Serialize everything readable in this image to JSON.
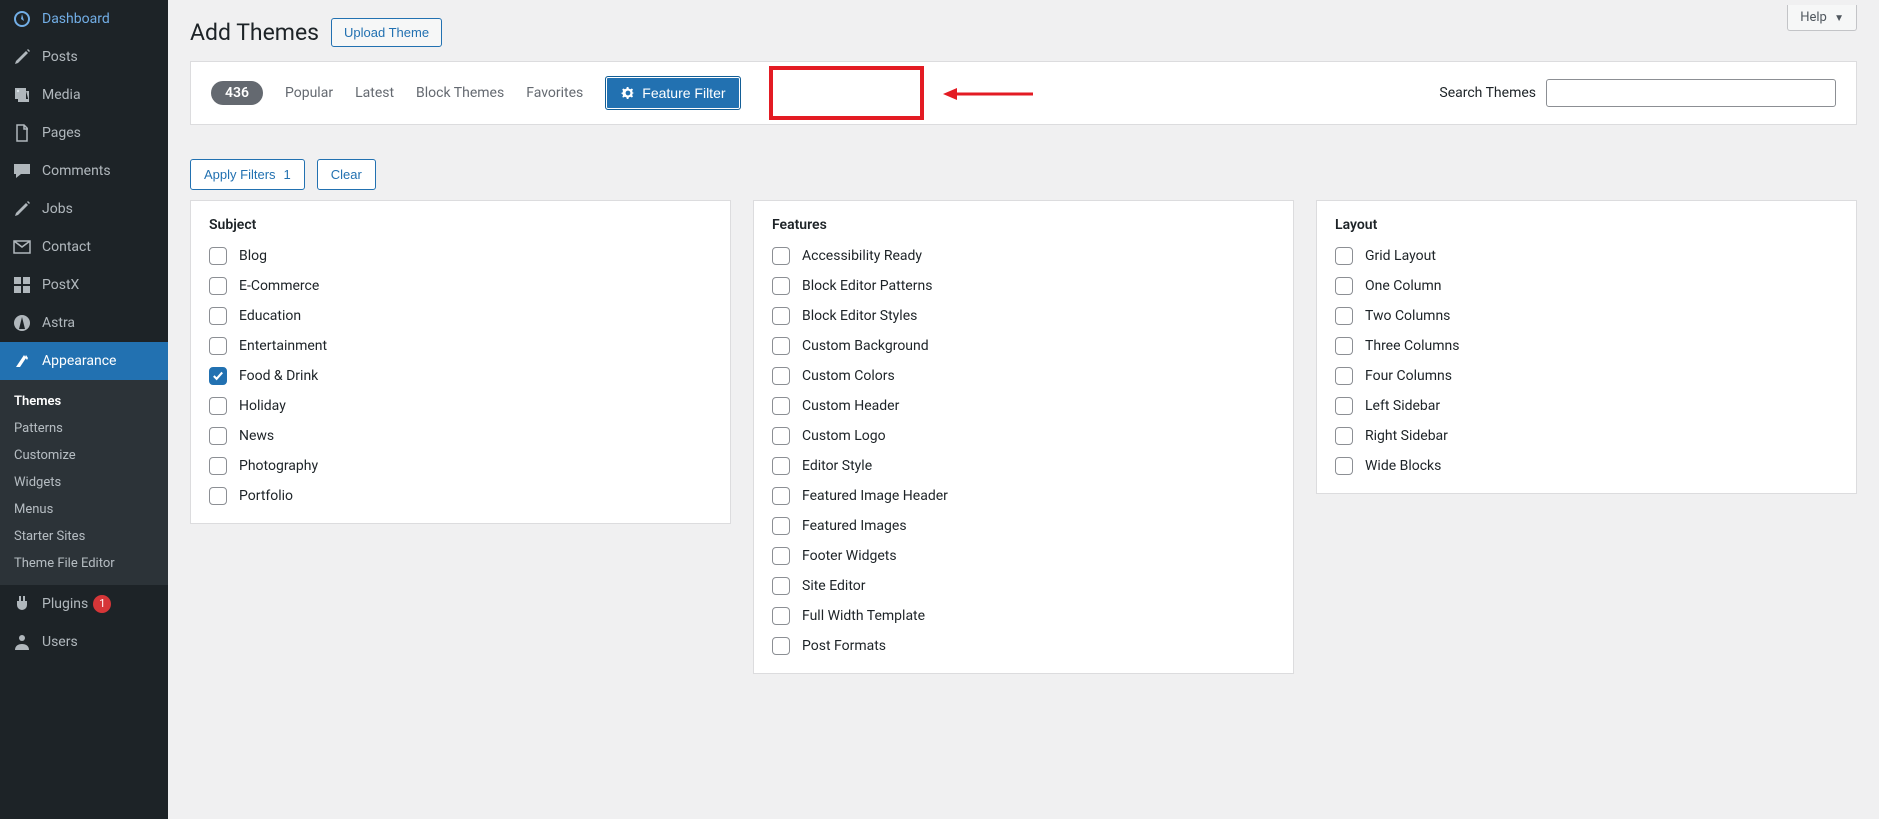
{
  "help": {
    "label": "Help"
  },
  "sidebar": {
    "items": [
      {
        "label": "Dashboard",
        "icon": "dashboard"
      },
      {
        "label": "Posts",
        "icon": "posts"
      },
      {
        "label": "Media",
        "icon": "media"
      },
      {
        "label": "Pages",
        "icon": "pages"
      },
      {
        "label": "Comments",
        "icon": "comments"
      },
      {
        "label": "Jobs",
        "icon": "posts"
      },
      {
        "label": "Contact",
        "icon": "contact"
      },
      {
        "label": "PostX",
        "icon": "postx"
      },
      {
        "label": "Astra",
        "icon": "astra"
      },
      {
        "label": "Appearance",
        "icon": "appearance",
        "current": true
      },
      {
        "label": "Plugins",
        "icon": "plugins",
        "badge": "1"
      },
      {
        "label": "Users",
        "icon": "users"
      }
    ],
    "submenu": [
      {
        "label": "Themes",
        "current": true
      },
      {
        "label": "Patterns"
      },
      {
        "label": "Customize"
      },
      {
        "label": "Widgets"
      },
      {
        "label": "Menus"
      },
      {
        "label": "Starter Sites"
      },
      {
        "label": "Theme File Editor"
      }
    ]
  },
  "header": {
    "title": "Add Themes",
    "upload_label": "Upload Theme"
  },
  "filter_bar": {
    "count": "436",
    "tabs": [
      "Popular",
      "Latest",
      "Block Themes",
      "Favorites"
    ],
    "feature_filter_label": "Feature Filter",
    "search_label": "Search Themes",
    "search_placeholder": ""
  },
  "actions": {
    "apply_label": "Apply Filters",
    "apply_count": "1",
    "clear_label": "Clear"
  },
  "filters": {
    "subject": {
      "title": "Subject",
      "items": [
        {
          "label": "Blog",
          "checked": false
        },
        {
          "label": "E-Commerce",
          "checked": false
        },
        {
          "label": "Education",
          "checked": false
        },
        {
          "label": "Entertainment",
          "checked": false
        },
        {
          "label": "Food & Drink",
          "checked": true
        },
        {
          "label": "Holiday",
          "checked": false
        },
        {
          "label": "News",
          "checked": false
        },
        {
          "label": "Photography",
          "checked": false
        },
        {
          "label": "Portfolio",
          "checked": false
        }
      ]
    },
    "features": {
      "title": "Features",
      "items": [
        {
          "label": "Accessibility Ready",
          "checked": false
        },
        {
          "label": "Block Editor Patterns",
          "checked": false
        },
        {
          "label": "Block Editor Styles",
          "checked": false
        },
        {
          "label": "Custom Background",
          "checked": false
        },
        {
          "label": "Custom Colors",
          "checked": false
        },
        {
          "label": "Custom Header",
          "checked": false
        },
        {
          "label": "Custom Logo",
          "checked": false
        },
        {
          "label": "Editor Style",
          "checked": false
        },
        {
          "label": "Featured Image Header",
          "checked": false
        },
        {
          "label": "Featured Images",
          "checked": false
        },
        {
          "label": "Footer Widgets",
          "checked": false
        },
        {
          "label": "Site Editor",
          "checked": false
        },
        {
          "label": "Full Width Template",
          "checked": false
        },
        {
          "label": "Post Formats",
          "checked": false
        }
      ]
    },
    "layout": {
      "title": "Layout",
      "items": [
        {
          "label": "Grid Layout",
          "checked": false
        },
        {
          "label": "One Column",
          "checked": false
        },
        {
          "label": "Two Columns",
          "checked": false
        },
        {
          "label": "Three Columns",
          "checked": false
        },
        {
          "label": "Four Columns",
          "checked": false
        },
        {
          "label": "Left Sidebar",
          "checked": false
        },
        {
          "label": "Right Sidebar",
          "checked": false
        },
        {
          "label": "Wide Blocks",
          "checked": false
        }
      ]
    }
  }
}
